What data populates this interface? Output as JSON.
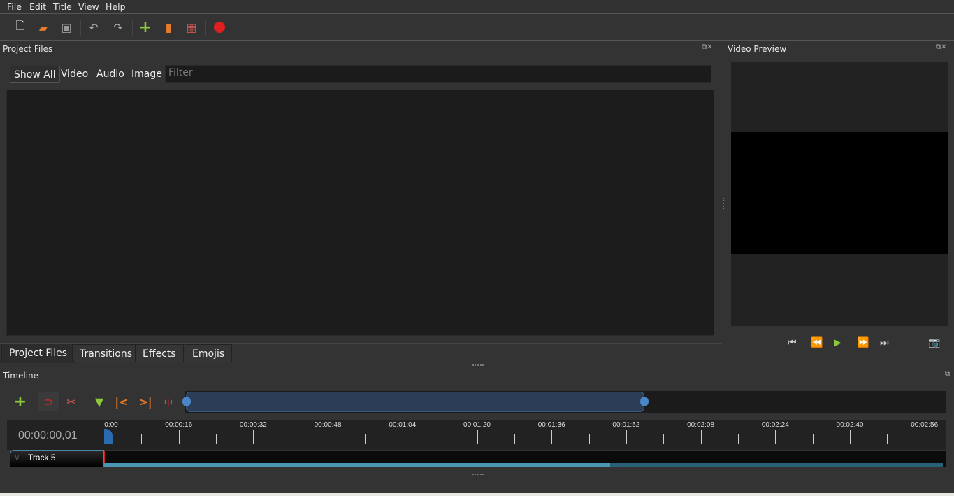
{
  "menu": [
    "File",
    "Edit",
    "Title",
    "View",
    "Help"
  ],
  "toolbar": [
    "new-project-icon",
    "open-project-icon",
    "save-project-icon",
    "undo-icon",
    "redo-icon",
    "import-files-icon",
    "profile-icon",
    "fullscreen-icon",
    "export-video-icon"
  ],
  "project_files": {
    "title": "Project Files",
    "filters": [
      "Show All",
      "Video",
      "Audio",
      "Image"
    ],
    "filter_placeholder": "Filter"
  },
  "bottom_tabs": [
    "Project Files",
    "Transitions",
    "Effects",
    "Emojis"
  ],
  "video_preview": {
    "title": "Video Preview",
    "controls": [
      "jump-start-icon",
      "rewind-icon",
      "play-icon",
      "fast-forward-icon",
      "jump-end-icon",
      "camera-icon"
    ]
  },
  "timeline": {
    "title": "Timeline",
    "current_time": "00:00:00,01",
    "ruler_labels": [
      "0:00",
      "00:00:16",
      "00:00:32",
      "00:00:48",
      "00:01:04",
      "00:01:20",
      "00:01:36",
      "00:01:52",
      "00:02:08",
      "00:02:24",
      "00:02:40",
      "00:02:56"
    ],
    "track_name": "Track 5"
  },
  "colors": {
    "accent": "#4a86c8",
    "play": "#8cc83c",
    "record": "#e02020"
  }
}
